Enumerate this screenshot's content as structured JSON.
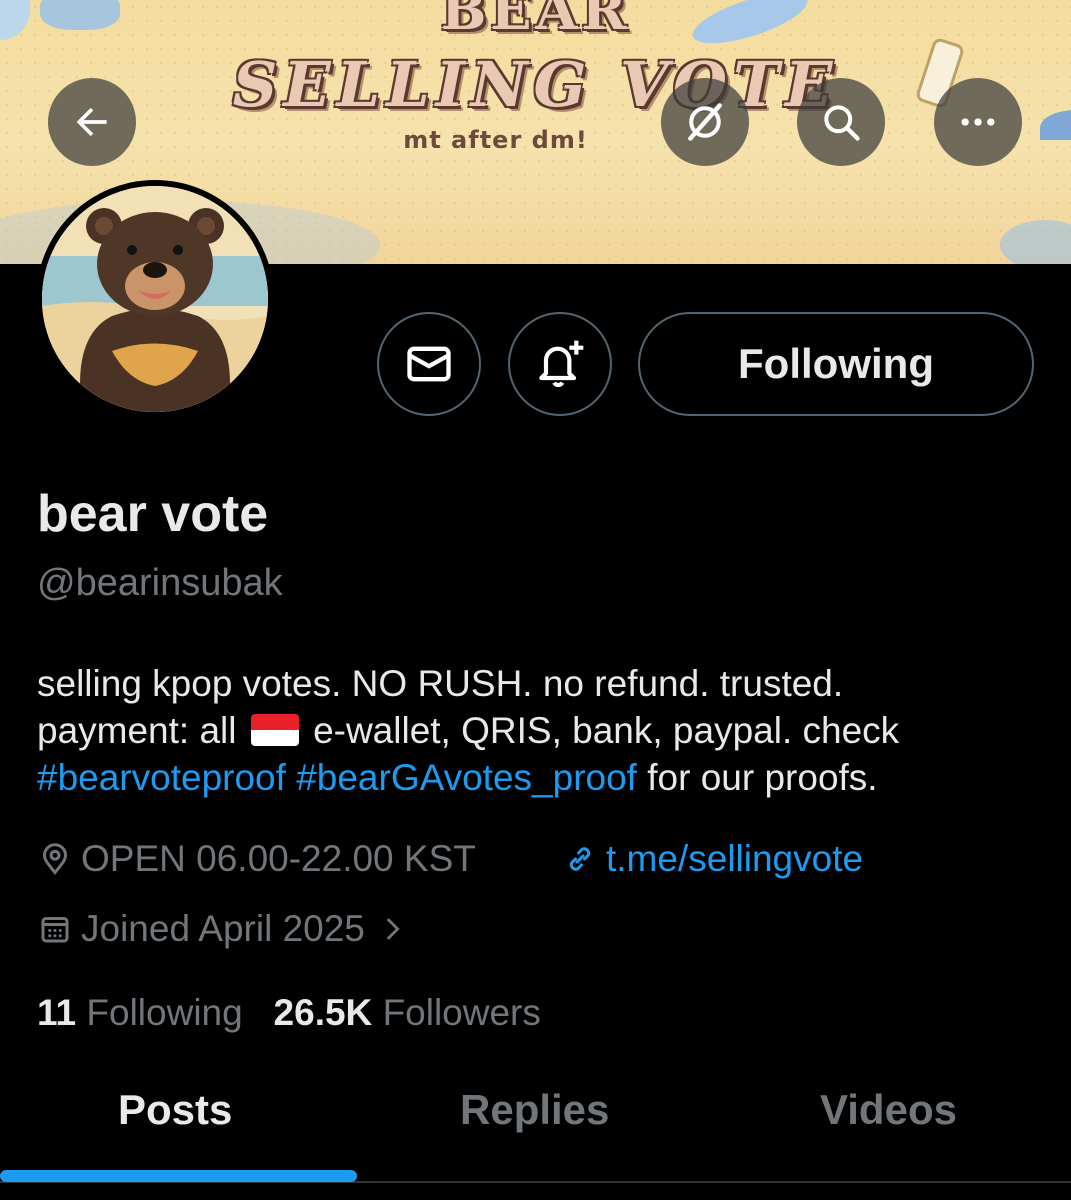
{
  "banner": {
    "title_top": "BEAR",
    "title_main": "SELLING VOTE",
    "subtitle": "mt after dm!"
  },
  "header": {
    "back_icon": "arrow-left-icon",
    "grok_icon": "grok-icon",
    "search_icon": "search-icon",
    "more_icon": "more-dots-icon"
  },
  "profile": {
    "name": "bear vote",
    "handle": "@bearinsubak",
    "bio_line1": "selling kpop votes. NO RUSH. no refund. trusted.",
    "bio_line2_a": "payment: all",
    "bio_line2_b": "e-wallet, QRIS, bank, paypal. check",
    "bio_tag1": "#bearvoteproof",
    "bio_tag2": "#bearGAvotes_proof",
    "bio_line3_end": "for our proofs.",
    "location": "OPEN 06.00-22.00 KST",
    "website": "t.me/sellingvote",
    "joined": "Joined April 2025",
    "following_count": "11",
    "following_label": "Following",
    "followers_count": "26.5K",
    "followers_label": "Followers"
  },
  "actions": {
    "message_icon": "envelope-icon",
    "notify_icon": "bell-plus-icon",
    "follow_label": "Following"
  },
  "tabs": [
    {
      "label": "Posts",
      "active": true
    },
    {
      "label": "Replies",
      "active": false
    },
    {
      "label": "Videos",
      "active": false
    }
  ],
  "colors": {
    "accent": "#1d9bf0",
    "muted": "#71767b",
    "text": "#e7e9ea",
    "background": "#000000"
  }
}
